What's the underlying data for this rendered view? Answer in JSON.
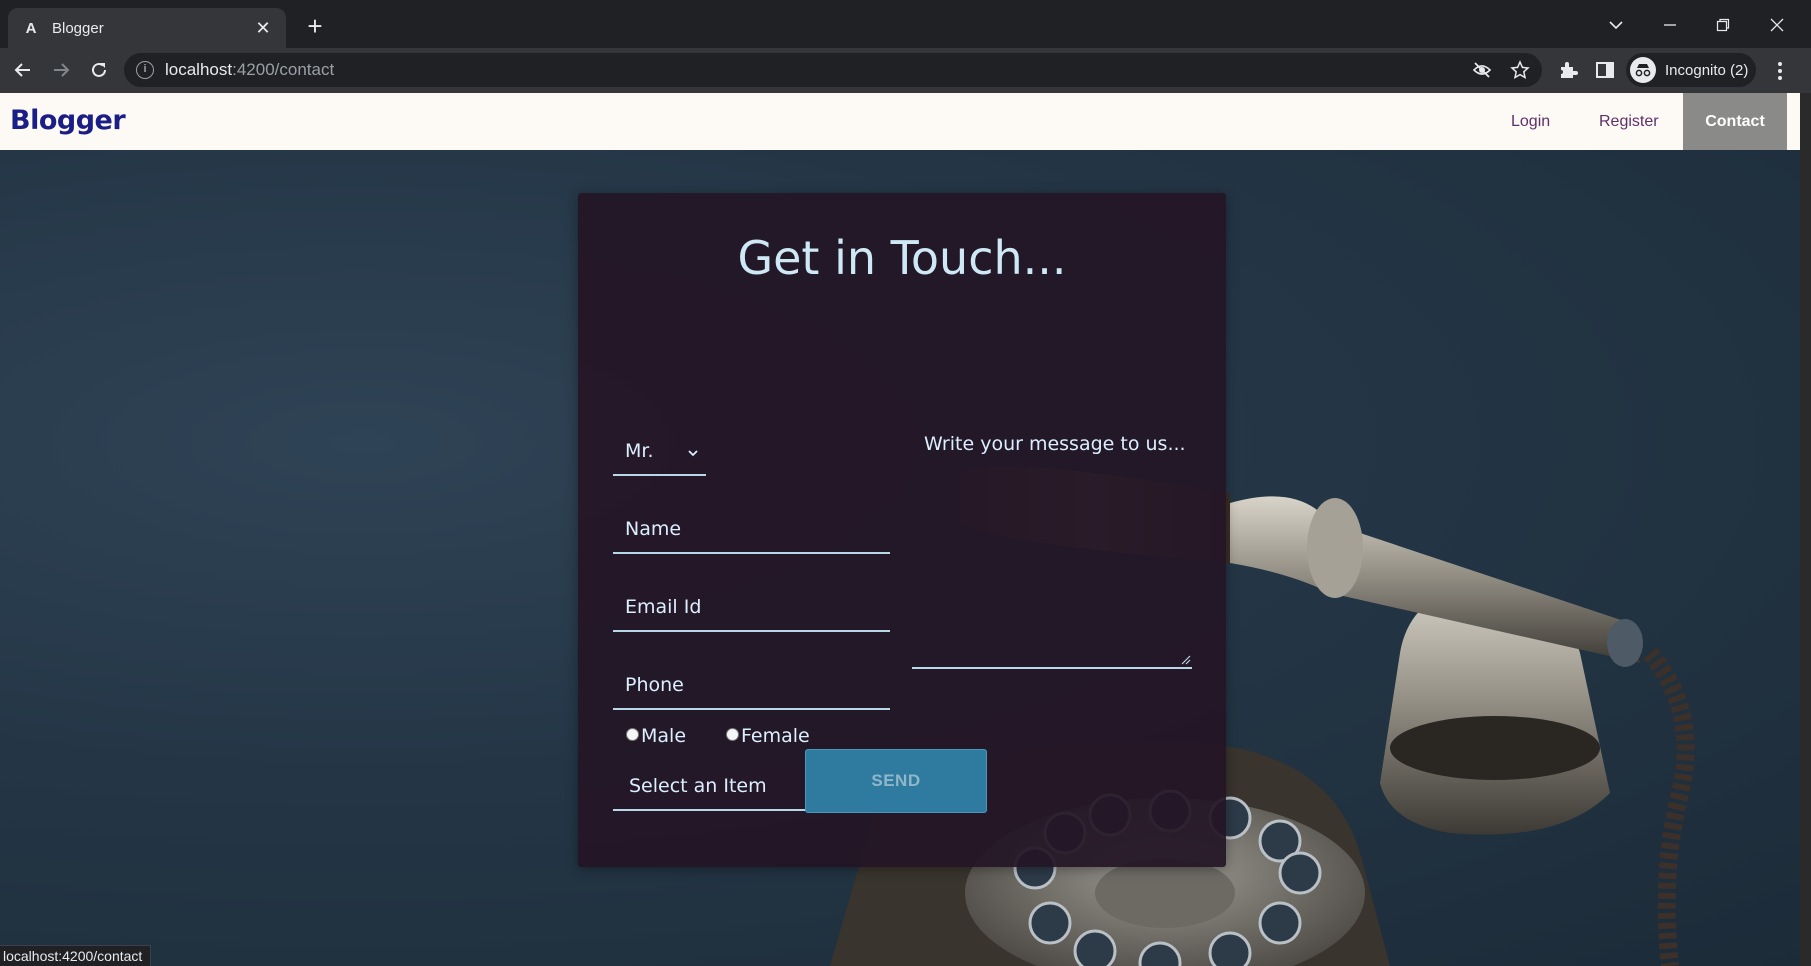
{
  "browser": {
    "tab_title": "Blogger",
    "url_host": "localhost",
    "url_path": ":4200/contact",
    "profile_label": "Incognito (2)",
    "status_text": "localhost:4200/contact"
  },
  "navbar": {
    "brand": "Blogger",
    "links": [
      "Login",
      "Register",
      "Contact"
    ],
    "active": "Contact"
  },
  "form": {
    "title": "Get in Touch...",
    "salutation": "Mr.",
    "name_placeholder": "Name",
    "email_placeholder": "Email Id",
    "phone_placeholder": "Phone",
    "gender_options": [
      "Male",
      "Female"
    ],
    "item_select": "Select an Item",
    "message_placeholder": "Write your message to us...",
    "send_label": "SEND"
  },
  "colors": {
    "brand": "#1a1e86",
    "nav_link": "#5e3068",
    "active_tab_bg": "#8a8a88",
    "card_bg": "#241626",
    "field_text": "#dcefff",
    "send_bg": "#2f7b9f"
  }
}
